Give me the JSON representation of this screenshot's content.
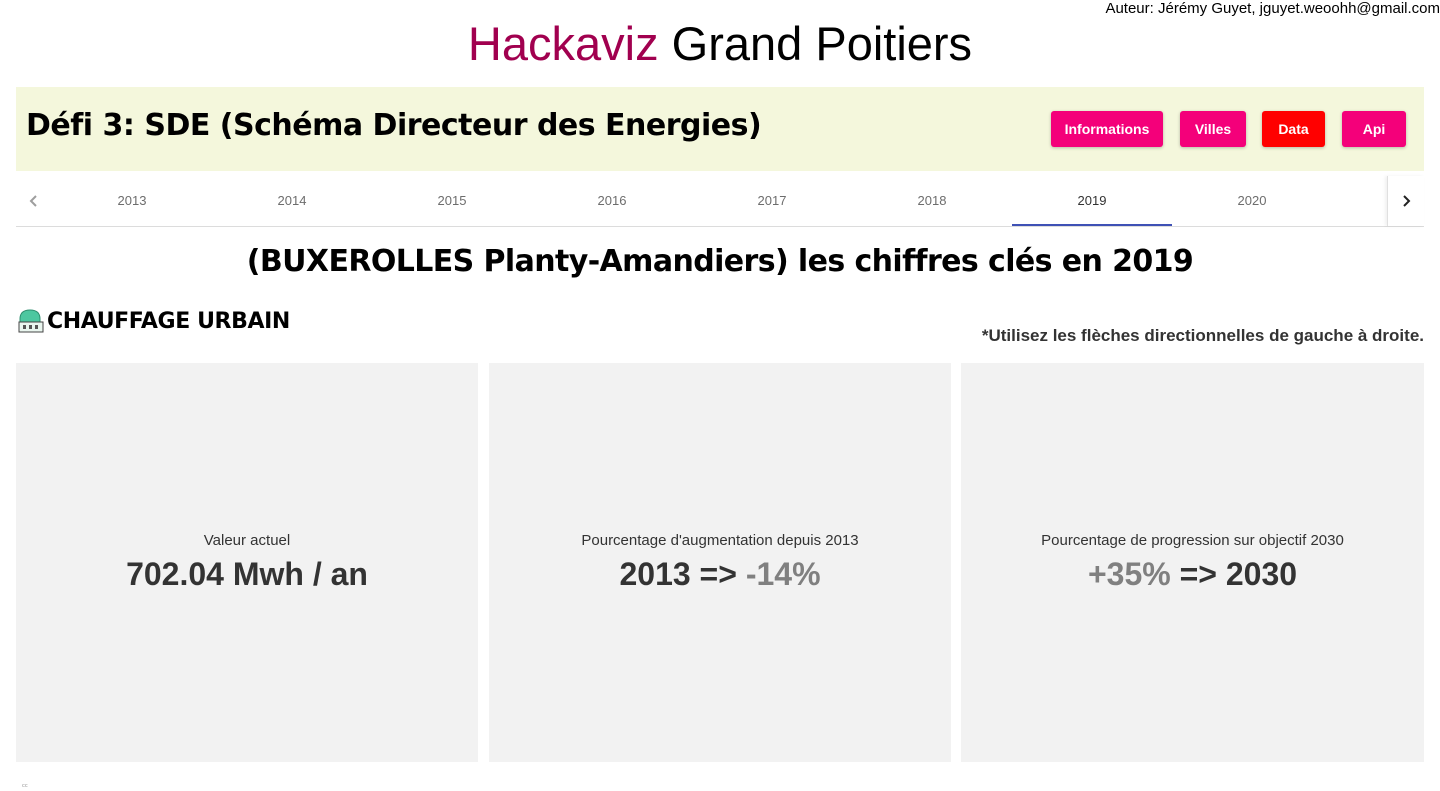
{
  "header": {
    "author": "Auteur: Jérémy Guyet, jguyet.weoohh@gmail.com",
    "brand": "Hackaviz",
    "city": "Grand Poitiers"
  },
  "banner": {
    "title": "Défi 3: SDE (Schéma Directeur des Energies)",
    "buttons": [
      {
        "label": "Informations",
        "color": "#f4007a"
      },
      {
        "label": "Villes",
        "color": "#f4007a"
      },
      {
        "label": "Data",
        "color": "#ff0000"
      },
      {
        "label": "Api",
        "color": "#f4007a"
      }
    ]
  },
  "tabs": {
    "items": [
      "2013",
      "2014",
      "2015",
      "2016",
      "2017",
      "2018",
      "2019",
      "2020"
    ],
    "active": "2019",
    "left_icon": "chevron-left-icon",
    "right_icon": "chevron-right-icon",
    "indicator_color": "#3f51b5"
  },
  "main": {
    "headline": "(BUXEROLLES Planty-Amandiers) les chiffres clés en 2019",
    "section_icon": "district-heating-icon",
    "section_title": "CHAUFFAGE URBAIN",
    "hint": "*Utilisez les flèches directionnelles de gauche à droite."
  },
  "cards": [
    {
      "label": "Valeur actuel",
      "value": "702.04 Mwh / an"
    },
    {
      "label": "Pourcentage d'augmentation depuis 2013",
      "value_prefix": "2013 => ",
      "value_highlight": "-14%"
    },
    {
      "label": "Pourcentage de progression sur objectif 2030",
      "value_highlight": "+35%",
      "value_suffix": " => 2030"
    }
  ],
  "footer": {
    "mark": "ᶜᶜ"
  }
}
